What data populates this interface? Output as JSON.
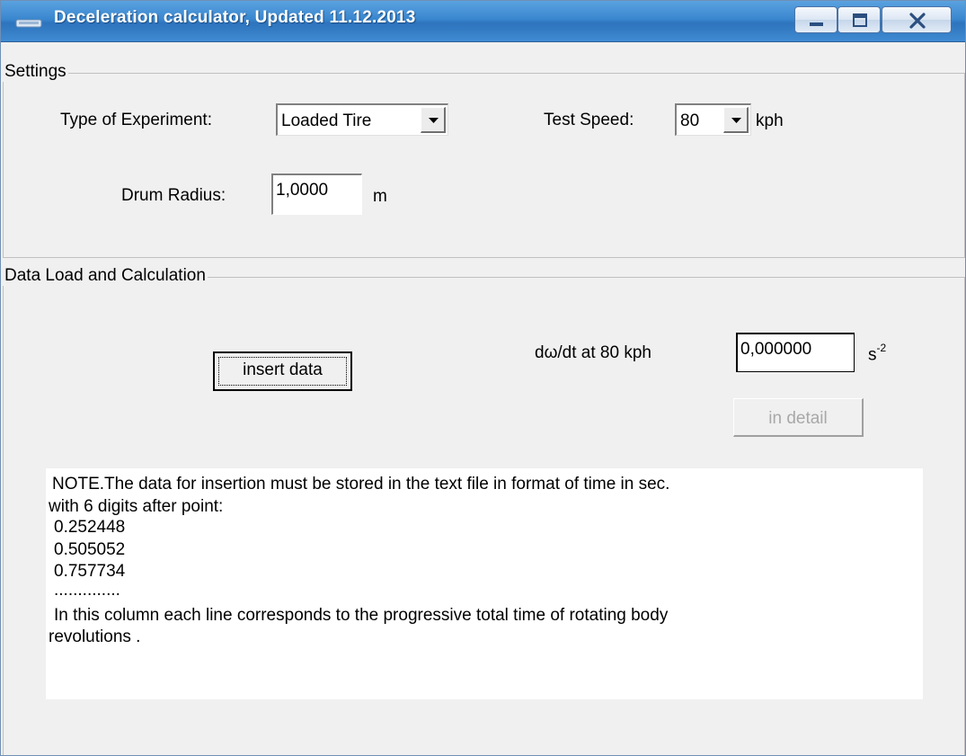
{
  "window": {
    "title": "Deceleration calculator, Updated 11.12.2013",
    "title_bar_color": "#3a87cf",
    "controls": [
      "minimize-icon",
      "maximize-icon",
      "close-icon"
    ]
  },
  "settings": {
    "group_label": "Settings",
    "experiment_label": "Type of Experiment:",
    "experiment_value": "Loaded Tire",
    "speed_label": "Test Speed:",
    "speed_value": "80",
    "speed_unit": "kph",
    "radius_label": "Drum Radius:",
    "radius_value": "1,0000",
    "radius_unit": "m"
  },
  "data_load": {
    "group_label": "Data Load and Calculation",
    "insert_button": "insert data",
    "result_label": "dω/dt at 80 kph",
    "result_value": "0,000000",
    "result_unit_base": "s",
    "result_unit_exp": "-2",
    "detail_button": "in detail",
    "note_lines": [
      "NOTE.The data for insertion must be stored in the text file in format of time in sec.",
      " with 6 digits after point:",
      "  0.252448",
      "  0.505052",
      "  0.757734",
      "  ..............",
      "  In this column each line corresponds to the progressive total time of rotating body",
      "revolutions ."
    ]
  }
}
